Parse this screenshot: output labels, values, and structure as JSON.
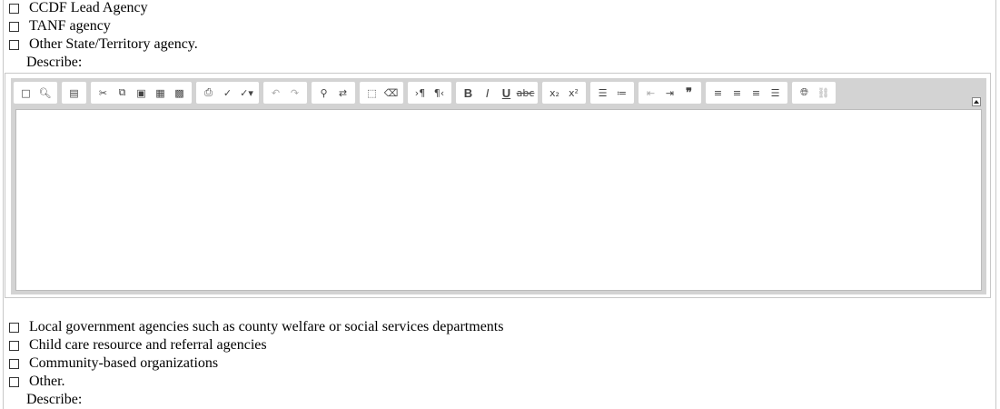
{
  "top_options": [
    {
      "label": "CCDF Lead Agency",
      "checked": false
    },
    {
      "label": "TANF agency",
      "checked": false
    },
    {
      "label": "Other State/Territory agency.",
      "checked": false
    }
  ],
  "describe_label_1": "Describe:",
  "editor": {
    "toolbar_icons": [
      "new-page-icon",
      "preview-icon",
      "templates-icon",
      "cut-icon",
      "copy-icon",
      "paste-icon",
      "paste-text-icon",
      "paste-word-icon",
      "print-icon",
      "spellcheck-icon",
      "spellcheck-as-you-type-icon",
      "undo-icon",
      "redo-icon",
      "find-icon",
      "replace-icon",
      "select-all-icon",
      "remove-format-icon",
      "ltr-icon",
      "rtl-icon",
      "bold-icon",
      "italic-icon",
      "underline-icon",
      "strike-icon",
      "subscript-icon",
      "superscript-icon",
      "numbered-list-icon",
      "bulleted-list-icon",
      "outdent-icon",
      "indent-icon",
      "blockquote-icon",
      "align-left-icon",
      "align-center-icon",
      "align-right-icon",
      "justify-icon",
      "link-icon",
      "unlink-icon",
      "collapse-icon"
    ],
    "content": ""
  },
  "bottom_options": [
    {
      "label": "Local government agencies such as county welfare or social services departments",
      "checked": false
    },
    {
      "label": "Child care resource and referral agencies",
      "checked": false
    },
    {
      "label": "Community-based organizations",
      "checked": false
    },
    {
      "label": "Other.",
      "checked": false
    }
  ],
  "describe_label_2": "Describe:"
}
